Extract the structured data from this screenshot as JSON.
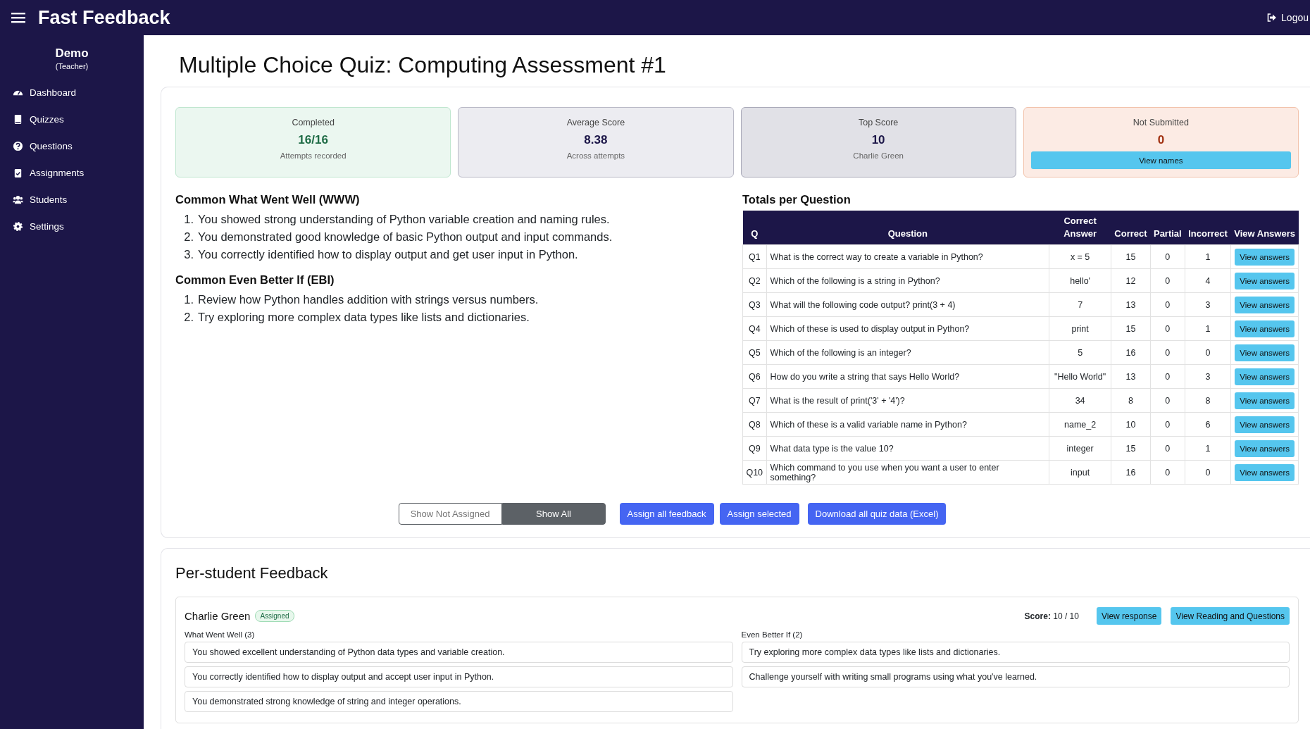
{
  "header": {
    "title": "Fast Feedback",
    "logout": "Logou"
  },
  "sidebar": {
    "user": "Demo",
    "role": "(Teacher)",
    "items": [
      {
        "label": "Dashboard"
      },
      {
        "label": "Quizzes"
      },
      {
        "label": "Questions"
      },
      {
        "label": "Assignments"
      },
      {
        "label": "Students"
      },
      {
        "label": "Settings"
      }
    ]
  },
  "page_title": "Multiple Choice Quiz: Computing Assessment #1",
  "stats": [
    {
      "kind": "success",
      "label": "Completed",
      "value": "16/16",
      "caption": "Attempts recorded"
    },
    {
      "kind": "neutral",
      "label": "Average Score",
      "value": "8.38",
      "caption": "Across attempts"
    },
    {
      "kind": "dark",
      "label": "Top Score",
      "value": "10",
      "caption": "Charlie Green"
    },
    {
      "kind": "danger",
      "label": "Not Submitted",
      "value": "0",
      "button": "View names"
    }
  ],
  "www": {
    "title": "Common What Went Well (WWW)",
    "items": [
      {
        "marker": "1.",
        "text": "You showed strong understanding of Python variable creation and naming rules."
      },
      {
        "marker": "2.",
        "text": "You demonstrated good knowledge of basic Python output and input commands."
      },
      {
        "marker": "3.",
        "text": "You correctly identified how to display output and get user input in Python."
      }
    ]
  },
  "ebi": {
    "title": "Common Even Better If (EBI)",
    "items": [
      {
        "marker": "1.",
        "text": "Review how Python handles addition with strings versus numbers."
      },
      {
        "marker": "2.",
        "text": "Try exploring more complex data types like lists and dictionaries."
      }
    ]
  },
  "totals": {
    "title": "Totals per Question",
    "columns": [
      "Q",
      "Question",
      "Correct Answer",
      "Correct",
      "Partial",
      "Incorrect",
      "View Answers"
    ],
    "rows": [
      {
        "q": "Q1",
        "question": "What is the correct way to create a variable in Python?",
        "answer": "x = 5",
        "correct": "15",
        "partial": "0",
        "incorrect": "1",
        "action": "View answers"
      },
      {
        "q": "Q2",
        "question": "Which of the following is a string in Python?",
        "answer": "hello'",
        "correct": "12",
        "partial": "0",
        "incorrect": "4",
        "action": "View answers"
      },
      {
        "q": "Q3",
        "question": "What will the following code output? print(3 + 4)",
        "answer": "7",
        "correct": "13",
        "partial": "0",
        "incorrect": "3",
        "action": "View answers"
      },
      {
        "q": "Q4",
        "question": "Which of these is used to display output in Python?",
        "answer": "print",
        "correct": "15",
        "partial": "0",
        "incorrect": "1",
        "action": "View answers"
      },
      {
        "q": "Q5",
        "question": "Which of the following is an integer?",
        "answer": "5",
        "correct": "16",
        "partial": "0",
        "incorrect": "0",
        "action": "View answers"
      },
      {
        "q": "Q6",
        "question": "How do you write a string that says Hello World?",
        "answer": "\"Hello World\"",
        "correct": "13",
        "partial": "0",
        "incorrect": "3",
        "action": "View answers"
      },
      {
        "q": "Q7",
        "question": "What is the result of print('3' + '4')?",
        "answer": "34",
        "correct": "8",
        "partial": "0",
        "incorrect": "8",
        "action": "View answers"
      },
      {
        "q": "Q8",
        "question": "Which of these is a valid variable name in Python?",
        "answer": "name_2",
        "correct": "10",
        "partial": "0",
        "incorrect": "6",
        "action": "View answers"
      },
      {
        "q": "Q9",
        "question": "What data type is the value 10?",
        "answer": "integer",
        "correct": "15",
        "partial": "0",
        "incorrect": "1",
        "action": "View answers"
      },
      {
        "q": "Q10",
        "question": "Which command to you use when you want a user to enter something?",
        "answer": "input",
        "correct": "16",
        "partial": "0",
        "incorrect": "0",
        "action": "View answers"
      }
    ]
  },
  "filter": [
    {
      "label": "Show Not Assigned",
      "selected": false
    },
    {
      "label": "Show All",
      "selected": true
    }
  ],
  "actions": [
    "Assign all feedback",
    "Assign selected",
    "Download all quiz data (Excel)"
  ],
  "per_student": {
    "title": "Per-student Feedback",
    "students": [
      {
        "name": "Charlie Green",
        "status": "Assigned",
        "score_label": "Score:",
        "score": "10 / 10",
        "buttons": [
          "View response",
          "View Reading and Questions"
        ],
        "www": {
          "title": "What Went Well (3)",
          "items": [
            "You showed excellent understanding of Python data types and variable creation.",
            "You correctly identified how to display output and accept user input in Python.",
            "You demonstrated strong knowledge of string and integer operations."
          ]
        },
        "ebi": {
          "title": "Even Better If (2)",
          "items": [
            "Try exploring more complex data types like lists and dictionaries.",
            "Challenge yourself with writing small programs using what you've learned."
          ]
        }
      }
    ]
  }
}
